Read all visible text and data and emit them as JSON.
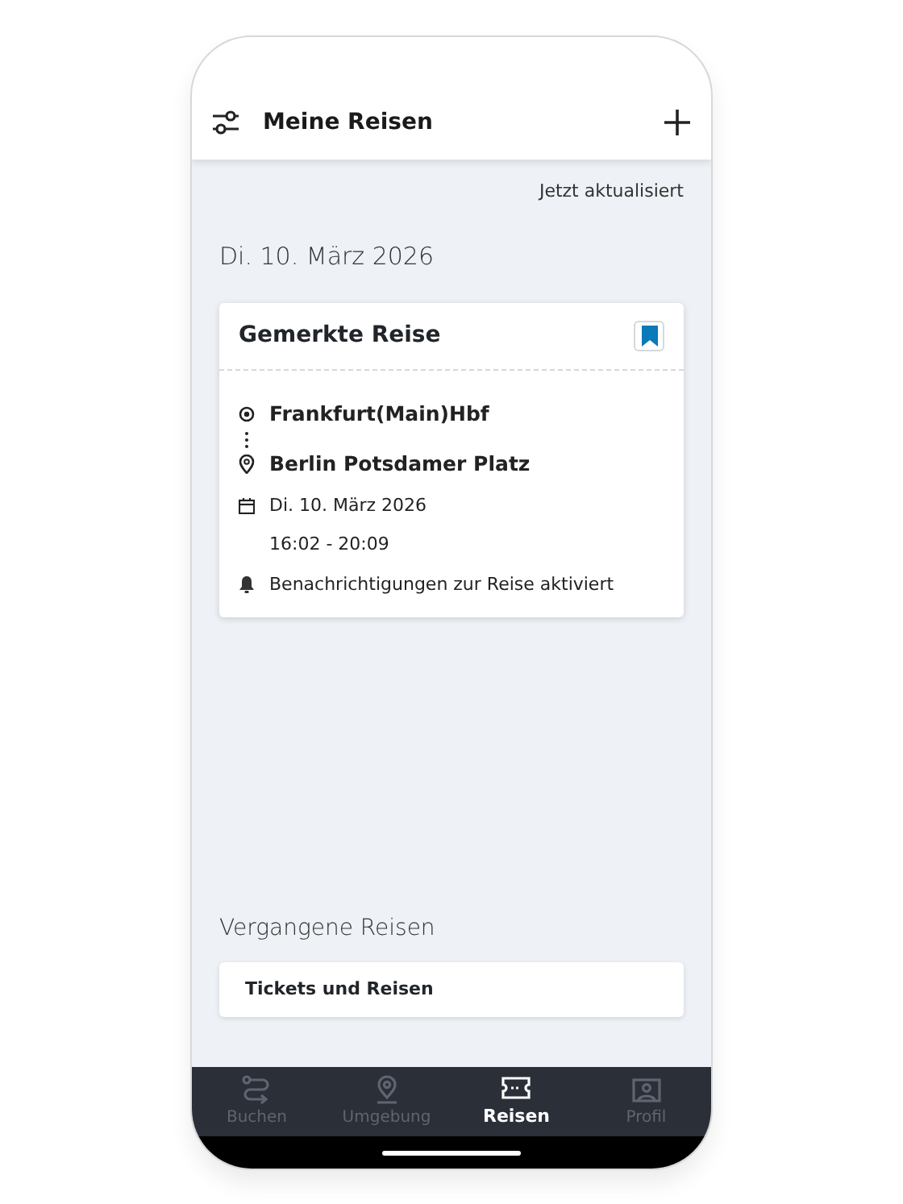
{
  "header": {
    "title": "Meine Reisen"
  },
  "update_status": "Jetzt aktualisiert",
  "date_heading": "Di. 10. März 2026",
  "saved_trip": {
    "title": "Gemerkte Reise",
    "bookmarked": true,
    "from": "Frankfurt(Main)Hbf",
    "to": "Berlin Potsdamer Platz",
    "date": "Di. 10. März 2026",
    "time": "16:02 - 20:09",
    "notification": "Benachrichtigungen zur Reise aktiviert"
  },
  "past_heading": "Vergangene Reisen",
  "past_link": "Tickets und Reisen",
  "nav": [
    {
      "label": "Buchen",
      "kind": "route",
      "selected": false
    },
    {
      "label": "Umgebung",
      "kind": "pin",
      "selected": false
    },
    {
      "label": "Reisen",
      "kind": "ticket",
      "selected": true
    },
    {
      "label": "Profil",
      "kind": "profile",
      "selected": false
    }
  ]
}
